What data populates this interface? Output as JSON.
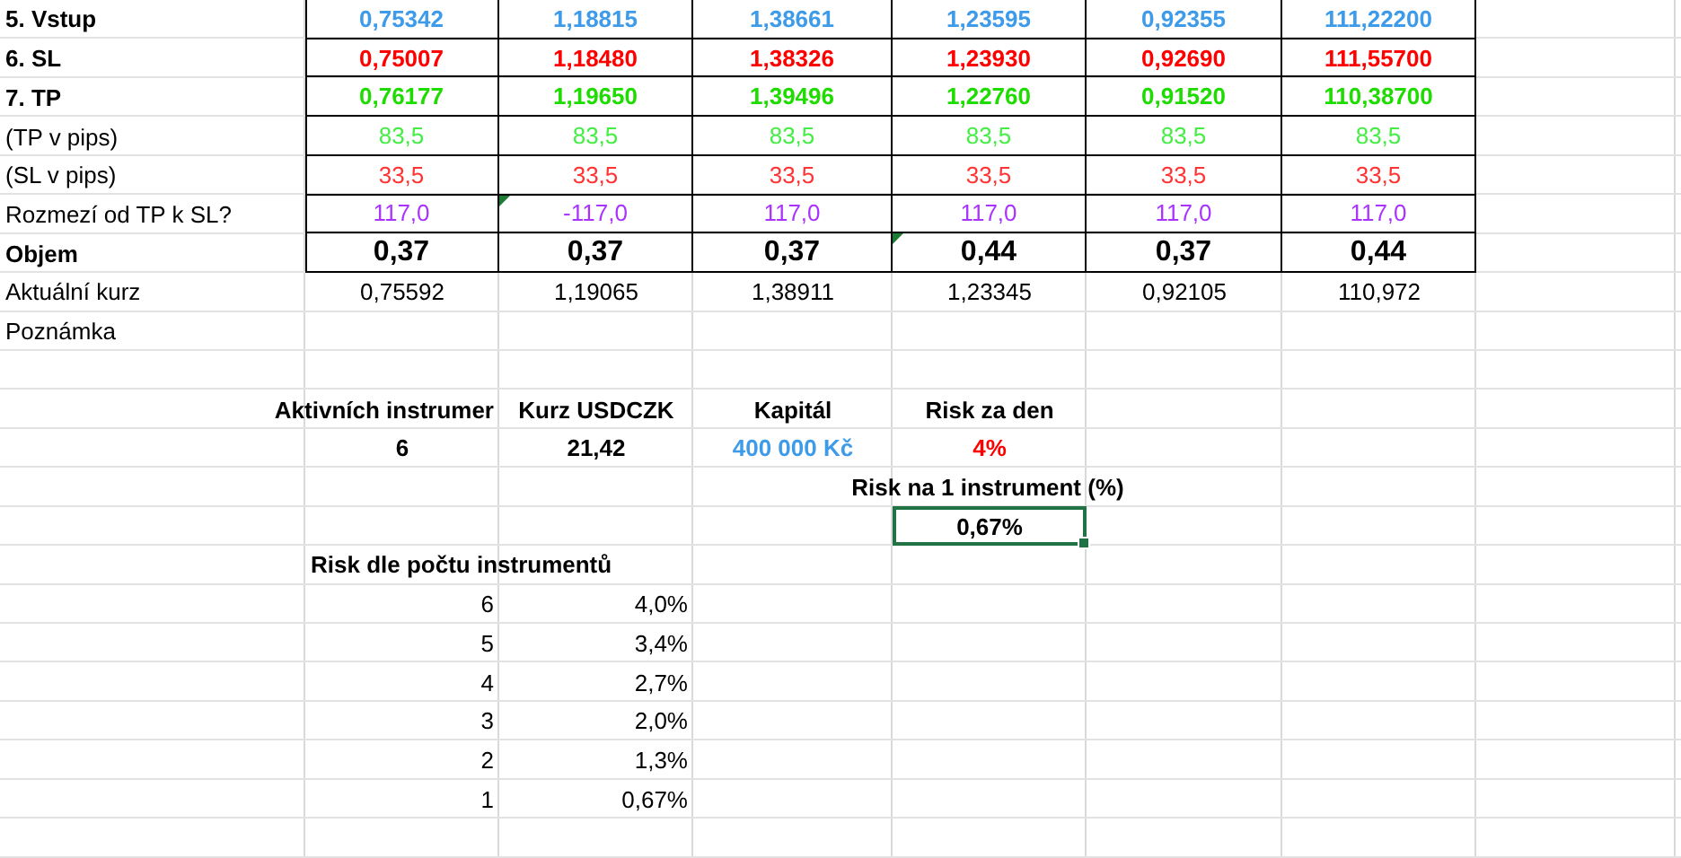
{
  "table": {
    "rows": [
      {
        "label": "5. Vstup",
        "kind": "bold",
        "color": "#3d9be9",
        "cells": [
          {
            "text": "0,75342"
          },
          {
            "text": "1,18815"
          },
          {
            "text": "1,38661"
          },
          {
            "text": "1,23595"
          },
          {
            "text": "0,92355"
          },
          {
            "text": "111,22200"
          }
        ]
      },
      {
        "label": "6. SL",
        "kind": "bold",
        "color": "#ff0000",
        "cells": [
          {
            "text": "0,75007"
          },
          {
            "text": "1,18480"
          },
          {
            "text": "1,38326"
          },
          {
            "text": "1,23930"
          },
          {
            "text": "0,92690"
          },
          {
            "text": "111,55700"
          }
        ]
      },
      {
        "label": "7. TP",
        "kind": "bold",
        "color": "#1fdc00",
        "cells": [
          {
            "text": "0,76177"
          },
          {
            "text": "1,19650"
          },
          {
            "text": "1,39496"
          },
          {
            "text": "1,22760"
          },
          {
            "text": "0,91520"
          },
          {
            "text": "110,38700"
          }
        ]
      },
      {
        "label": "(TP v pips)",
        "kind": "plain",
        "color": "#44ee44",
        "cells": [
          {
            "text": "83,5"
          },
          {
            "text": "83,5"
          },
          {
            "text": "83,5"
          },
          {
            "text": "83,5"
          },
          {
            "text": "83,5"
          },
          {
            "text": "83,5"
          }
        ]
      },
      {
        "label": "(SL v pips)",
        "kind": "plain",
        "color": "#ff3333",
        "cells": [
          {
            "text": "33,5"
          },
          {
            "text": "33,5"
          },
          {
            "text": "33,5"
          },
          {
            "text": "33,5"
          },
          {
            "text": "33,5"
          },
          {
            "text": "33,5"
          }
        ]
      },
      {
        "label": "Rozmezí od TP k SL?",
        "kind": "plain",
        "color": "#aa33ff",
        "cells": [
          {
            "text": "117,0",
            "note": false
          },
          {
            "text": "-117,0",
            "note": true
          },
          {
            "text": "117,0",
            "note": false
          },
          {
            "text": "117,0",
            "note": false
          },
          {
            "text": "117,0",
            "note": false
          },
          {
            "text": "117,0",
            "note": false
          }
        ]
      },
      {
        "label": "Objem",
        "kind": "large",
        "color": "#000000",
        "cells": [
          {
            "text": "0,37",
            "note": false
          },
          {
            "text": "0,37",
            "note": false
          },
          {
            "text": "0,37",
            "note": false
          },
          {
            "text": "0,44",
            "note": true
          },
          {
            "text": "0,37",
            "note": false
          },
          {
            "text": "0,44",
            "note": false
          }
        ]
      },
      {
        "label": "Aktuální kurz",
        "kind": "loose",
        "color": "#000000",
        "cells": [
          {
            "text": "0,75592"
          },
          {
            "text": "1,19065"
          },
          {
            "text": "1,38911"
          },
          {
            "text": "1,23345"
          },
          {
            "text": "0,92105"
          },
          {
            "text": "110,972"
          }
        ]
      },
      {
        "label": "Poznámka",
        "kind": "loose"
      }
    ]
  },
  "summary": {
    "headers": [
      "Aktivních instrumer",
      "Kurz USDCZK",
      "Kapitál",
      "Risk za den"
    ],
    "values": [
      {
        "text": "6",
        "color": "#000000"
      },
      {
        "text": "21,42",
        "color": "#000000"
      },
      {
        "text": "400 000 Kč",
        "color": "#3d9be9"
      },
      {
        "text": "4%",
        "color": "#ff0000"
      }
    ]
  },
  "risk_per_instrument": {
    "label": "Risk na 1 instrument (%)",
    "value": "0,67%",
    "selected": true
  },
  "risk_by_count": {
    "title": "Risk dle počtu instrumentů",
    "rows": [
      {
        "count": "6",
        "risk": "4,0%"
      },
      {
        "count": "5",
        "risk": "3,4%"
      },
      {
        "count": "4",
        "risk": "2,7%"
      },
      {
        "count": "3",
        "risk": "2,0%"
      },
      {
        "count": "2",
        "risk": "1,3%"
      },
      {
        "count": "1",
        "risk": "0,67%"
      }
    ]
  }
}
